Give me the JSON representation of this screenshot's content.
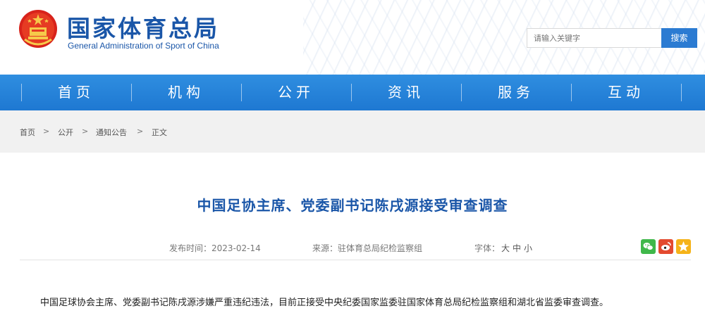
{
  "header": {
    "title": "国家体育总局",
    "subtitle": "General Administration of Sport of China",
    "emblem_icon": "national-emblem-icon"
  },
  "search": {
    "placeholder": "请输入关键字",
    "button_label": "搜索"
  },
  "nav": {
    "items": [
      "首页",
      "机构",
      "公开",
      "资讯",
      "服务",
      "互动"
    ]
  },
  "breadcrumb": {
    "items": [
      "首页",
      "公开",
      "通知公告",
      "正文"
    ],
    "separator": ">"
  },
  "article": {
    "title": "中国足协主席、党委副书记陈戌源接受审查调查",
    "publish_label": "发布时间：",
    "publish_date": "2023-02-14",
    "source_label": "来源：",
    "source": "驻体育总局纪检监察组",
    "font_label": "字体：",
    "font_sizes": [
      "大",
      "中",
      "小"
    ],
    "share_icons": [
      "wechat-icon",
      "weibo-icon",
      "qzone-icon"
    ],
    "body": "中国足球协会主席、党委副书记陈戌源涉嫌严重违纪违法，目前正接受中央纪委国家监委驻国家体育总局纪检监察组和湖北省监委审查调查。"
  },
  "colors": {
    "brand_blue": "#1a56a8",
    "nav_blue": "#2784d9",
    "search_button": "#2b7bd2",
    "breadcrumb_bg": "#f1f1f1"
  }
}
